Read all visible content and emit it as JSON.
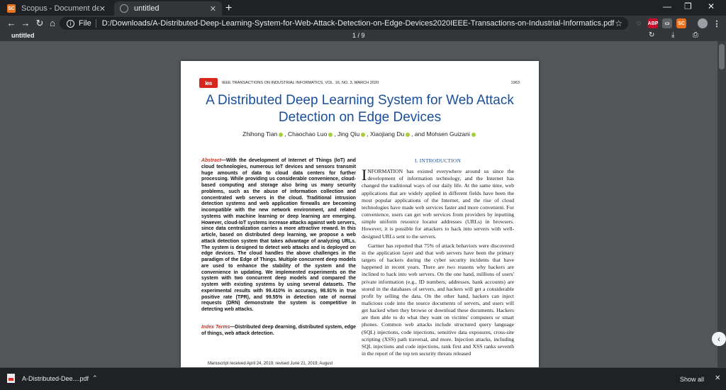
{
  "tabs": [
    {
      "title": "Scopus - Document details",
      "favicon": "SC",
      "active": false
    },
    {
      "title": "untitled",
      "favicon": "globe-icon",
      "active": true
    }
  ],
  "window": {
    "minimize": "—",
    "maximize": "❐",
    "close": "✕"
  },
  "toolbar": {
    "scheme": "File",
    "url": "D:/Downloads/A-Distributed-Deep-Learning-System-for-Web-Attack-Detection-on-Edge-Devices2020IEEE-Transactions-on-Industrial-Informatics.pdf",
    "extensions": [
      {
        "name": "abp",
        "label": "ABP",
        "color": "#c70d2c"
      },
      {
        "name": "extension",
        "label": "▭",
        "color": "#5f6368"
      },
      {
        "name": "scopus",
        "label": "SC",
        "color": "#e9711c"
      }
    ]
  },
  "pdf": {
    "title": "untitled",
    "page_indicator": "1 / 9"
  },
  "paper": {
    "logo": "ies",
    "journal": "IEEE TRANSACTIONS ON INDUSTRIAL INFORMATICS, VOL. 16, NO. 3, MARCH 2020",
    "page_number": "1963",
    "title": "A Distributed Deep Learning System for Web Attack Detection on Edge Devices",
    "authors": [
      "Zhihong Tian",
      "Chaochao Luo",
      "Jing Qiu",
      "Xiaojiang Du",
      "Mohsen Guizani"
    ],
    "abstract_label": "Abstract",
    "abstract": "—With the development of Internet of Things (IoT) and cloud technologies, numerous IoT devices and sensors transmit huge amounts of data to cloud data centers for further processing. While providing us considerable convenience, cloud-based computing and storage also bring us many security problems, such as the abuse of information collection and concentrated web servers in the cloud. Traditional intrusion detection systems and web application firewalls are becoming incompatible with the new network environment, and related systems with machine learning or deep learning are emerging. However, cloud-IoT systems increase attacks against web servers, since data centralization carries a more attractive reward. In this article, based on distributed deep learning, we propose a web attack detection system that takes advantage of analyzing URLs. The system is designed to detect web attacks and is deployed on edge devices. The cloud handles the above challenges in the paradigm of the Edge of Things. Multiple concurrent deep models are used to enhance the stability of the system and the convenience in updating. We implemented experiments on the system with two concurrent deep models and compared the system with existing systems by using several datasets. The experimental results with 99.410% in accuracy, 98.91% in true positive rate (TPR), and 99.55% in detection rate of normal requests (DRN) demonstrate the system is competitive in detecting web attacks.",
    "index_label": "Index Terms",
    "index_terms": "—Distributed deep dearning, distributed system, edge of things, web attack detection.",
    "manuscript": "Manuscript received April 24, 2019; revised June 21, 2019; August",
    "section_heading": "I. INTRODUCTION",
    "dropcap": "I",
    "intro_p1": "NFORMATION has existed everywhere around us since the development of information technology, and the Internet has changed the traditional ways of our daily life. At the same time, web applications that are widely applied in different fields have been the most popular applications of the Internet, and the rise of cloud technologies have made web services faster and more convenient. For convenience, users can get web services from providers by inputting simple uniform resource locator addresses (URLs) in browsers. However, it is possible for attackers to hack into servers with well-designed URLs sent to the servers.",
    "intro_p2": "Gartner has reported that 75% of attack behaviors were discovered in the application layer and that web servers have been the primary targets of hackers during the cyber security incidents that have happened in recent years. There are two reasons why hackers are inclined to hack into web servers. On the one hand, millions of users' private information (e.g., ID numbers, addresses, bank accounts) are stored in the databases of servers, and hackers will get a considerable profit by selling the data. On the other hand, hackers can inject malicious code into the source documents of servers, and users will get hacked when they browse or download these documents. Hackers are then able to do what they want on victims' computers or smart phones. Common web attacks include structured query language (SQL) injections, code injections, sensitive data exposures, cross-site scripting (XSS) path traversal, and more. Injection attacks, including SQL injections and code injections, rank first and XSS ranks seventh in the report of the top ten security threats released"
  },
  "downloads": {
    "filename": "A-Distributed-Dee....pdf",
    "show_all": "Show all"
  }
}
